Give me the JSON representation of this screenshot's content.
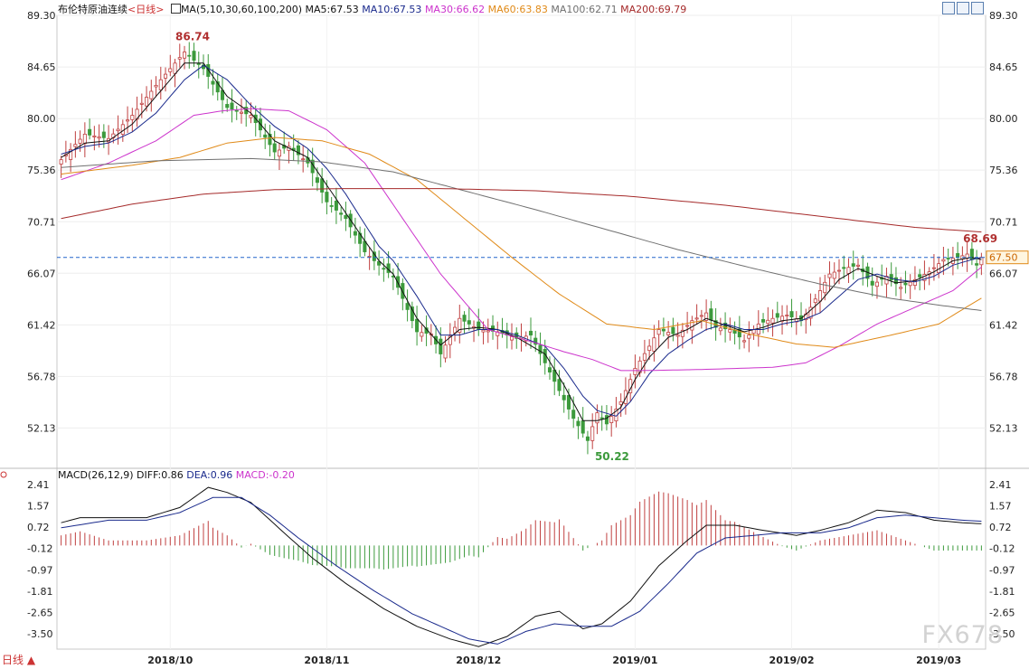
{
  "header": {
    "instrument": "布伦特原油连续",
    "period_tag": "<日线>",
    "ma_params": "MA(5,10,30,60,100,200)",
    "ma5": "MA5:67.53",
    "ma10": "MA10:67.53",
    "ma30": "MA30:66.62",
    "ma60": "MA60:63.83",
    "ma100": "MA100:62.71",
    "ma200": "MA200:69.79"
  },
  "macd_header": {
    "params": "MACD(26,12,9)",
    "diff": "DIFF:0.86",
    "dea": "DEA:0.96",
    "macd": "MACD:-0.20"
  },
  "toolbar": {
    "icons": [
      "chart-mode-icon",
      "chart-expand-icon",
      "chart-settings-icon"
    ]
  },
  "watermark": "FX678",
  "period_button": "日线 ▲",
  "colors": {
    "up": "#c04040",
    "down": "#3c9a3c",
    "ma5": "#111111",
    "ma10": "#1a2a8c",
    "ma30": "#cc33cc",
    "ma60": "#e08a18",
    "ma100": "#707070",
    "ma200": "#a52a2a",
    "price_line": "#2266cc",
    "diff": "#111111",
    "dea": "#1a2a8c"
  },
  "chart_data": [
    {
      "type": "candlestick",
      "y_ticks": [
        "89.30",
        "84.65",
        "80.00",
        "75.36",
        "70.71",
        "66.07",
        "61.42",
        "56.78",
        "52.13"
      ],
      "ylim": [
        48.5,
        89.3
      ],
      "x_labels": [
        "2018/10",
        "2018/11",
        "2018/12",
        "2019/01",
        "2019/02",
        "2019/03"
      ],
      "annotations": {
        "high": "86.74",
        "low": "50.22",
        "last_high": "68.69",
        "current_price": "67.50"
      },
      "current_price": 67.5,
      "ma_last": {
        "MA30": 66.62,
        "MA60": 63.83,
        "MA100": 62.71,
        "MA200": 69.79
      },
      "close_anchors": [
        [
          0,
          76.3
        ],
        [
          5,
          78.6
        ],
        [
          10,
          78.2
        ],
        [
          15,
          80.3
        ],
        [
          20,
          83.0
        ],
        [
          26,
          86.0
        ],
        [
          30,
          84.5
        ],
        [
          35,
          81.0
        ],
        [
          40,
          80.3
        ],
        [
          45,
          77.0
        ],
        [
          48,
          77.5
        ],
        [
          52,
          76.0
        ],
        [
          56,
          72.5
        ],
        [
          60,
          71.0
        ],
        [
          64,
          68.0
        ],
        [
          67,
          66.8
        ],
        [
          70,
          65.8
        ],
        [
          75,
          60.8
        ],
        [
          78,
          60.6
        ],
        [
          80,
          58.8
        ],
        [
          84,
          62.0
        ],
        [
          88,
          61.0
        ],
        [
          92,
          60.8
        ],
        [
          96,
          60.2
        ],
        [
          99,
          60.5
        ],
        [
          102,
          58.0
        ],
        [
          105,
          55.5
        ],
        [
          108,
          53.0
        ],
        [
          111,
          51.0
        ],
        [
          113,
          53.5
        ],
        [
          115,
          52.5
        ],
        [
          118,
          54.5
        ],
        [
          121,
          57.5
        ],
        [
          124,
          59.5
        ],
        [
          126,
          61.0
        ],
        [
          130,
          60.5
        ],
        [
          133,
          61.8
        ],
        [
          136,
          62.5
        ],
        [
          138,
          61.2
        ],
        [
          141,
          61.0
        ],
        [
          144,
          60.0
        ],
        [
          147,
          61.5
        ],
        [
          150,
          62.0
        ],
        [
          153,
          62.3
        ],
        [
          156,
          61.8
        ],
        [
          158,
          63.0
        ],
        [
          160,
          64.5
        ],
        [
          162,
          66.0
        ],
        [
          165,
          66.5
        ],
        [
          168,
          66.8
        ],
        [
          171,
          65.0
        ],
        [
          174,
          65.8
        ],
        [
          177,
          64.8
        ],
        [
          180,
          65.5
        ],
        [
          183,
          66.2
        ],
        [
          186,
          67.3
        ],
        [
          189,
          67.5
        ],
        [
          191,
          67.8
        ],
        [
          193,
          66.8
        ],
        [
          194,
          67.5
        ]
      ],
      "ma_anchors": {
        "MA5": [
          [
            0,
            76.5
          ],
          [
            5,
            77.8
          ],
          [
            10,
            78.0
          ],
          [
            15,
            79.5
          ],
          [
            20,
            82.0
          ],
          [
            26,
            85.0
          ],
          [
            30,
            85.0
          ],
          [
            35,
            82.0
          ],
          [
            40,
            80.5
          ],
          [
            45,
            78.0
          ],
          [
            52,
            76.5
          ],
          [
            56,
            74.0
          ],
          [
            60,
            71.5
          ],
          [
            64,
            69.0
          ],
          [
            67,
            67.2
          ],
          [
            70,
            66.0
          ],
          [
            75,
            62.0
          ],
          [
            80,
            59.6
          ],
          [
            84,
            61.0
          ],
          [
            88,
            61.2
          ],
          [
            92,
            61.0
          ],
          [
            96,
            60.3
          ],
          [
            102,
            58.8
          ],
          [
            106,
            56.0
          ],
          [
            110,
            52.8
          ],
          [
            113,
            52.8
          ],
          [
            115,
            53.0
          ],
          [
            118,
            54.0
          ],
          [
            121,
            56.5
          ],
          [
            124,
            58.5
          ],
          [
            128,
            60.3
          ],
          [
            132,
            61.0
          ],
          [
            136,
            62.0
          ],
          [
            140,
            61.4
          ],
          [
            144,
            60.8
          ],
          [
            148,
            61.2
          ],
          [
            152,
            61.8
          ],
          [
            156,
            62.0
          ],
          [
            160,
            63.5
          ],
          [
            164,
            65.5
          ],
          [
            168,
            66.5
          ],
          [
            172,
            65.8
          ],
          [
            176,
            65.2
          ],
          [
            180,
            65.4
          ],
          [
            184,
            66.2
          ],
          [
            188,
            67.2
          ],
          [
            192,
            67.5
          ],
          [
            194,
            67.3
          ]
        ],
        "MA10": [
          [
            0,
            76.8
          ],
          [
            5,
            77.5
          ],
          [
            10,
            77.8
          ],
          [
            15,
            78.8
          ],
          [
            20,
            80.5
          ],
          [
            26,
            83.5
          ],
          [
            30,
            84.8
          ],
          [
            35,
            83.5
          ],
          [
            40,
            81.2
          ],
          [
            45,
            79.3
          ],
          [
            52,
            77.3
          ],
          [
            56,
            75.5
          ],
          [
            60,
            73.2
          ],
          [
            64,
            70.5
          ],
          [
            67,
            68.5
          ],
          [
            70,
            67.2
          ],
          [
            75,
            64.0
          ],
          [
            80,
            60.5
          ],
          [
            84,
            60.5
          ],
          [
            88,
            61.0
          ],
          [
            92,
            61.0
          ],
          [
            96,
            60.5
          ],
          [
            102,
            59.5
          ],
          [
            106,
            57.5
          ],
          [
            110,
            55.0
          ],
          [
            113,
            53.7
          ],
          [
            117,
            53.2
          ],
          [
            120,
            54.5
          ],
          [
            124,
            57.0
          ],
          [
            128,
            58.8
          ],
          [
            132,
            60.0
          ],
          [
            136,
            61.0
          ],
          [
            140,
            61.5
          ],
          [
            144,
            61.0
          ],
          [
            148,
            61.0
          ],
          [
            152,
            61.5
          ],
          [
            156,
            61.8
          ],
          [
            160,
            62.5
          ],
          [
            164,
            64.0
          ],
          [
            168,
            65.5
          ],
          [
            172,
            66.0
          ],
          [
            176,
            65.5
          ],
          [
            180,
            65.3
          ],
          [
            184,
            65.8
          ],
          [
            188,
            66.8
          ],
          [
            192,
            67.3
          ],
          [
            194,
            67.5
          ]
        ],
        "MA30": [
          [
            0,
            74.5
          ],
          [
            10,
            76.0
          ],
          [
            20,
            78.0
          ],
          [
            28,
            80.3
          ],
          [
            34,
            80.7
          ],
          [
            40,
            80.9
          ],
          [
            48,
            80.7
          ],
          [
            56,
            79.0
          ],
          [
            64,
            76.0
          ],
          [
            72,
            71.0
          ],
          [
            80,
            66.0
          ],
          [
            90,
            61.0
          ],
          [
            100,
            59.8
          ],
          [
            106,
            59.0
          ],
          [
            112,
            58.3
          ],
          [
            118,
            57.3
          ],
          [
            122,
            57.3
          ],
          [
            135,
            57.4
          ],
          [
            150,
            57.6
          ],
          [
            157,
            58.0
          ],
          [
            164,
            59.5
          ],
          [
            172,
            61.5
          ],
          [
            180,
            63.0
          ],
          [
            188,
            64.5
          ],
          [
            194,
            66.62
          ]
        ],
        "MA60": [
          [
            0,
            75.0
          ],
          [
            15,
            75.8
          ],
          [
            25,
            76.5
          ],
          [
            35,
            77.8
          ],
          [
            45,
            78.3
          ],
          [
            55,
            78.0
          ],
          [
            65,
            76.8
          ],
          [
            75,
            74.5
          ],
          [
            85,
            71.0
          ],
          [
            95,
            67.5
          ],
          [
            105,
            64.2
          ],
          [
            115,
            61.5
          ],
          [
            125,
            61.0
          ],
          [
            135,
            61.8
          ],
          [
            145,
            60.6
          ],
          [
            155,
            59.7
          ],
          [
            163,
            59.4
          ],
          [
            175,
            60.5
          ],
          [
            185,
            61.5
          ],
          [
            190,
            62.8
          ],
          [
            194,
            63.83
          ]
        ],
        "MA100": [
          [
            0,
            75.6
          ],
          [
            20,
            76.2
          ],
          [
            40,
            76.4
          ],
          [
            55,
            76.1
          ],
          [
            70,
            75.2
          ],
          [
            85,
            73.5
          ],
          [
            100,
            71.8
          ],
          [
            115,
            70.0
          ],
          [
            130,
            68.2
          ],
          [
            145,
            66.6
          ],
          [
            160,
            65.1
          ],
          [
            175,
            63.8
          ],
          [
            185,
            63.2
          ],
          [
            194,
            62.71
          ]
        ],
        "MA200": [
          [
            0,
            71.0
          ],
          [
            15,
            72.3
          ],
          [
            30,
            73.2
          ],
          [
            45,
            73.6
          ],
          [
            60,
            73.7
          ],
          [
            80,
            73.7
          ],
          [
            100,
            73.5
          ],
          [
            120,
            73.0
          ],
          [
            140,
            72.2
          ],
          [
            160,
            71.2
          ],
          [
            180,
            70.2
          ],
          [
            194,
            69.79
          ]
        ]
      }
    },
    {
      "type": "macd",
      "params": "MACD(26,12,9)",
      "y_ticks": [
        "2.41",
        "1.57",
        "0.72",
        "-0.12",
        "-0.97",
        "-1.81",
        "-2.65",
        "-3.50"
      ],
      "ylim": [
        -4.1,
        2.41
      ],
      "diff_anchors": [
        [
          0,
          0.9
        ],
        [
          4,
          1.1
        ],
        [
          12,
          1.1
        ],
        [
          18,
          1.1
        ],
        [
          25,
          1.5
        ],
        [
          31,
          2.3
        ],
        [
          35,
          2.1
        ],
        [
          40,
          1.7
        ],
        [
          47,
          0.5
        ],
        [
          53,
          -0.5
        ],
        [
          60,
          -1.5
        ],
        [
          68,
          -2.5
        ],
        [
          75,
          -3.2
        ],
        [
          82,
          -3.7
        ],
        [
          88,
          -4.0
        ],
        [
          94,
          -3.6
        ],
        [
          100,
          -2.8
        ],
        [
          105,
          -2.6
        ],
        [
          110,
          -3.3
        ],
        [
          114,
          -3.1
        ],
        [
          120,
          -2.2
        ],
        [
          126,
          -0.8
        ],
        [
          132,
          0.2
        ],
        [
          136,
          0.8
        ],
        [
          142,
          0.8
        ],
        [
          148,
          0.6
        ],
        [
          155,
          0.4
        ],
        [
          160,
          0.6
        ],
        [
          166,
          0.9
        ],
        [
          172,
          1.4
        ],
        [
          178,
          1.3
        ],
        [
          184,
          1.0
        ],
        [
          190,
          0.9
        ],
        [
          194,
          0.86
        ]
      ],
      "dea_anchors": [
        [
          0,
          0.7
        ],
        [
          10,
          1.0
        ],
        [
          18,
          1.0
        ],
        [
          25,
          1.3
        ],
        [
          32,
          1.9
        ],
        [
          38,
          1.9
        ],
        [
          44,
          1.2
        ],
        [
          50,
          0.3
        ],
        [
          58,
          -0.8
        ],
        [
          66,
          -1.8
        ],
        [
          74,
          -2.7
        ],
        [
          80,
          -3.2
        ],
        [
          86,
          -3.7
        ],
        [
          92,
          -3.9
        ],
        [
          98,
          -3.4
        ],
        [
          104,
          -3.1
        ],
        [
          110,
          -3.2
        ],
        [
          116,
          -3.2
        ],
        [
          122,
          -2.6
        ],
        [
          128,
          -1.5
        ],
        [
          134,
          -0.3
        ],
        [
          140,
          0.3
        ],
        [
          146,
          0.4
        ],
        [
          152,
          0.5
        ],
        [
          160,
          0.5
        ],
        [
          166,
          0.7
        ],
        [
          172,
          1.1
        ],
        [
          178,
          1.2
        ],
        [
          184,
          1.1
        ],
        [
          190,
          1.0
        ],
        [
          194,
          0.96
        ]
      ],
      "macd_last": -0.2
    }
  ]
}
